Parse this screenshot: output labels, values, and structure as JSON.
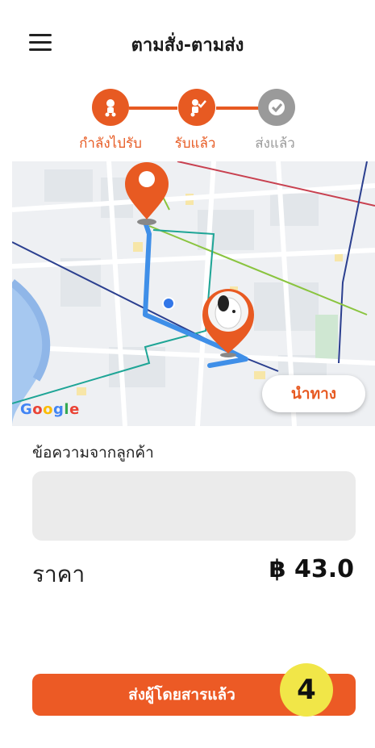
{
  "header": {
    "title": "ตามสั่ง-ตามส่ง"
  },
  "stepper": {
    "steps": [
      {
        "label": "กำลังไปรับ",
        "status": "done"
      },
      {
        "label": "รับแล้ว",
        "status": "done"
      },
      {
        "label": "ส่งแล้ว",
        "status": "pending"
      }
    ],
    "active_color": "#e75a22",
    "inactive_color": "#9a9a9a"
  },
  "map": {
    "navigate_label": "นำทาง",
    "provider": "Google"
  },
  "message": {
    "label": "ข้อความจากลูกค้า",
    "value": ""
  },
  "price": {
    "label": "ราคา",
    "value": "฿ 43.0"
  },
  "action": {
    "label": "ส่งผู้โดยสารแล้ว",
    "badge": "4"
  }
}
